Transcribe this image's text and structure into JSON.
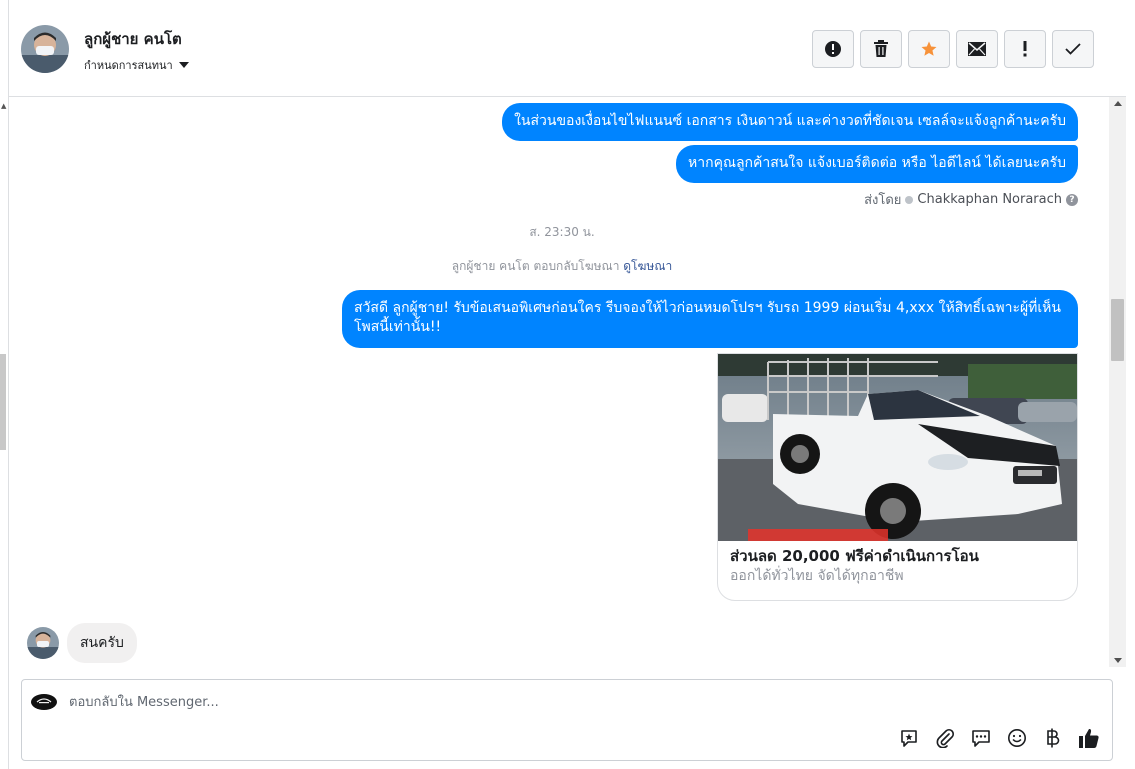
{
  "header": {
    "contact_name": "ลูกผู้ชาย คนโต",
    "conversation_settings": "กำหนดการสนทนา",
    "actions": [
      {
        "name": "mark-spam-button",
        "icon": "alert-circle-icon"
      },
      {
        "name": "delete-button",
        "icon": "trash-icon"
      },
      {
        "name": "star-button",
        "icon": "star-icon"
      },
      {
        "name": "mark-unread-button",
        "icon": "envelope-icon"
      },
      {
        "name": "follow-up-button",
        "icon": "exclamation-icon"
      },
      {
        "name": "mark-done-button",
        "icon": "check-icon"
      }
    ]
  },
  "thread": {
    "messages_out_top": [
      "ในส่วนของเงื่อนไขไฟแนนซ์ เอกสาร เงินดาวน์ และค่างวดที่ชัดเจน เซลล์จะแจ้งลูกค้านะครับ",
      "หากคุณลูกค้าสนใจ แจ้งเบอร์ติดต่อ หรือ ไอดีไลน์ ได้เลยนะครับ"
    ],
    "sent_by_label": "ส่งโดย",
    "sent_by_name": "Chakkaphan Norarach",
    "timestamp": "ส. 23:30 น.",
    "ad_reply_text": "ลูกผู้ชาย คนโต ตอบกลับโฆษณา",
    "ad_reply_link": "ดูโฆษณา",
    "ad_message": "สวัสดี ลูกผู้ชาย! รับข้อเสนอพิเศษก่อนใคร รีบจองให้ไวก่อนหมดโปรฯ รับรถ 1999 ผ่อนเริ่ม 4,xxx ให้สิทธิ์เฉพาะผู้ที่เห็นโพสนี้เท่านั้น!!",
    "ad_card": {
      "title": "ส่วนลด 20,000 ฟรีค่าดำเนินการโอน",
      "subtitle": "ออกได้ทั่วไทย จัดได้ทุกอาชีพ",
      "image": "white-isuzu-pickup-truck-photo"
    },
    "incoming_message": "สนครับ"
  },
  "composer": {
    "placeholder": "ตอบกลับใน Messenger...",
    "tools": [
      "saved-reply-icon",
      "paperclip-icon",
      "chat-bubble-icon",
      "smiley-icon",
      "baht-icon",
      "thumbs-up-icon"
    ]
  },
  "colors": {
    "bubble_out": "#0084ff",
    "bubble_in": "#f1f0f0",
    "star": "#f7923a"
  }
}
